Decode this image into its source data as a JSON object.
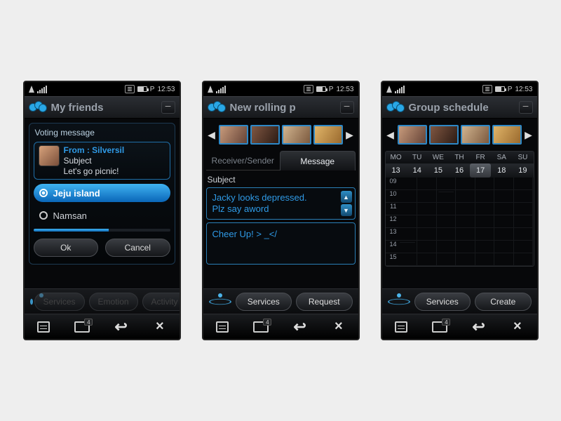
{
  "status": {
    "carrier_prefix": "P",
    "time": "12:53",
    "window_badge": "4"
  },
  "phone1": {
    "title": "My friends",
    "voting": {
      "panel_label": "Voting message",
      "from": "From : Silversil",
      "subject_label": "Subject",
      "body": "Let's go picnic!",
      "options": [
        {
          "label": "Jeju island",
          "selected": true
        },
        {
          "label": "Namsan",
          "selected": false
        }
      ],
      "ok": "Ok",
      "cancel": "Cancel"
    },
    "svc": {
      "services": "Services",
      "emotion": "Emotion",
      "activity": "Activity"
    }
  },
  "phone2": {
    "title": "New rolling p",
    "tabs": {
      "receiver": "Receiver/Sender",
      "message": "Message"
    },
    "subject_label": "Subject",
    "subject_text": "Jacky looks depressed.\nPlz say aword",
    "message_text": "Cheer Up! > _</",
    "svc": {
      "services": "Services",
      "request": "Request"
    }
  },
  "phone3": {
    "title": "Group schedule",
    "days": [
      "MO",
      "TU",
      "WE",
      "TH",
      "FR",
      "SA",
      "SU"
    ],
    "dates": [
      "13",
      "14",
      "15",
      "16",
      "17",
      "18",
      "19"
    ],
    "selected_day_index": 4,
    "hours": [
      "09",
      "10",
      "11",
      "12",
      "13",
      "14",
      "15"
    ],
    "events": [
      {
        "day_index": 2,
        "hour_index": 1
      },
      {
        "day_index": 0,
        "hour_index": 5
      }
    ],
    "svc": {
      "services": "Services",
      "create": "Create"
    }
  }
}
